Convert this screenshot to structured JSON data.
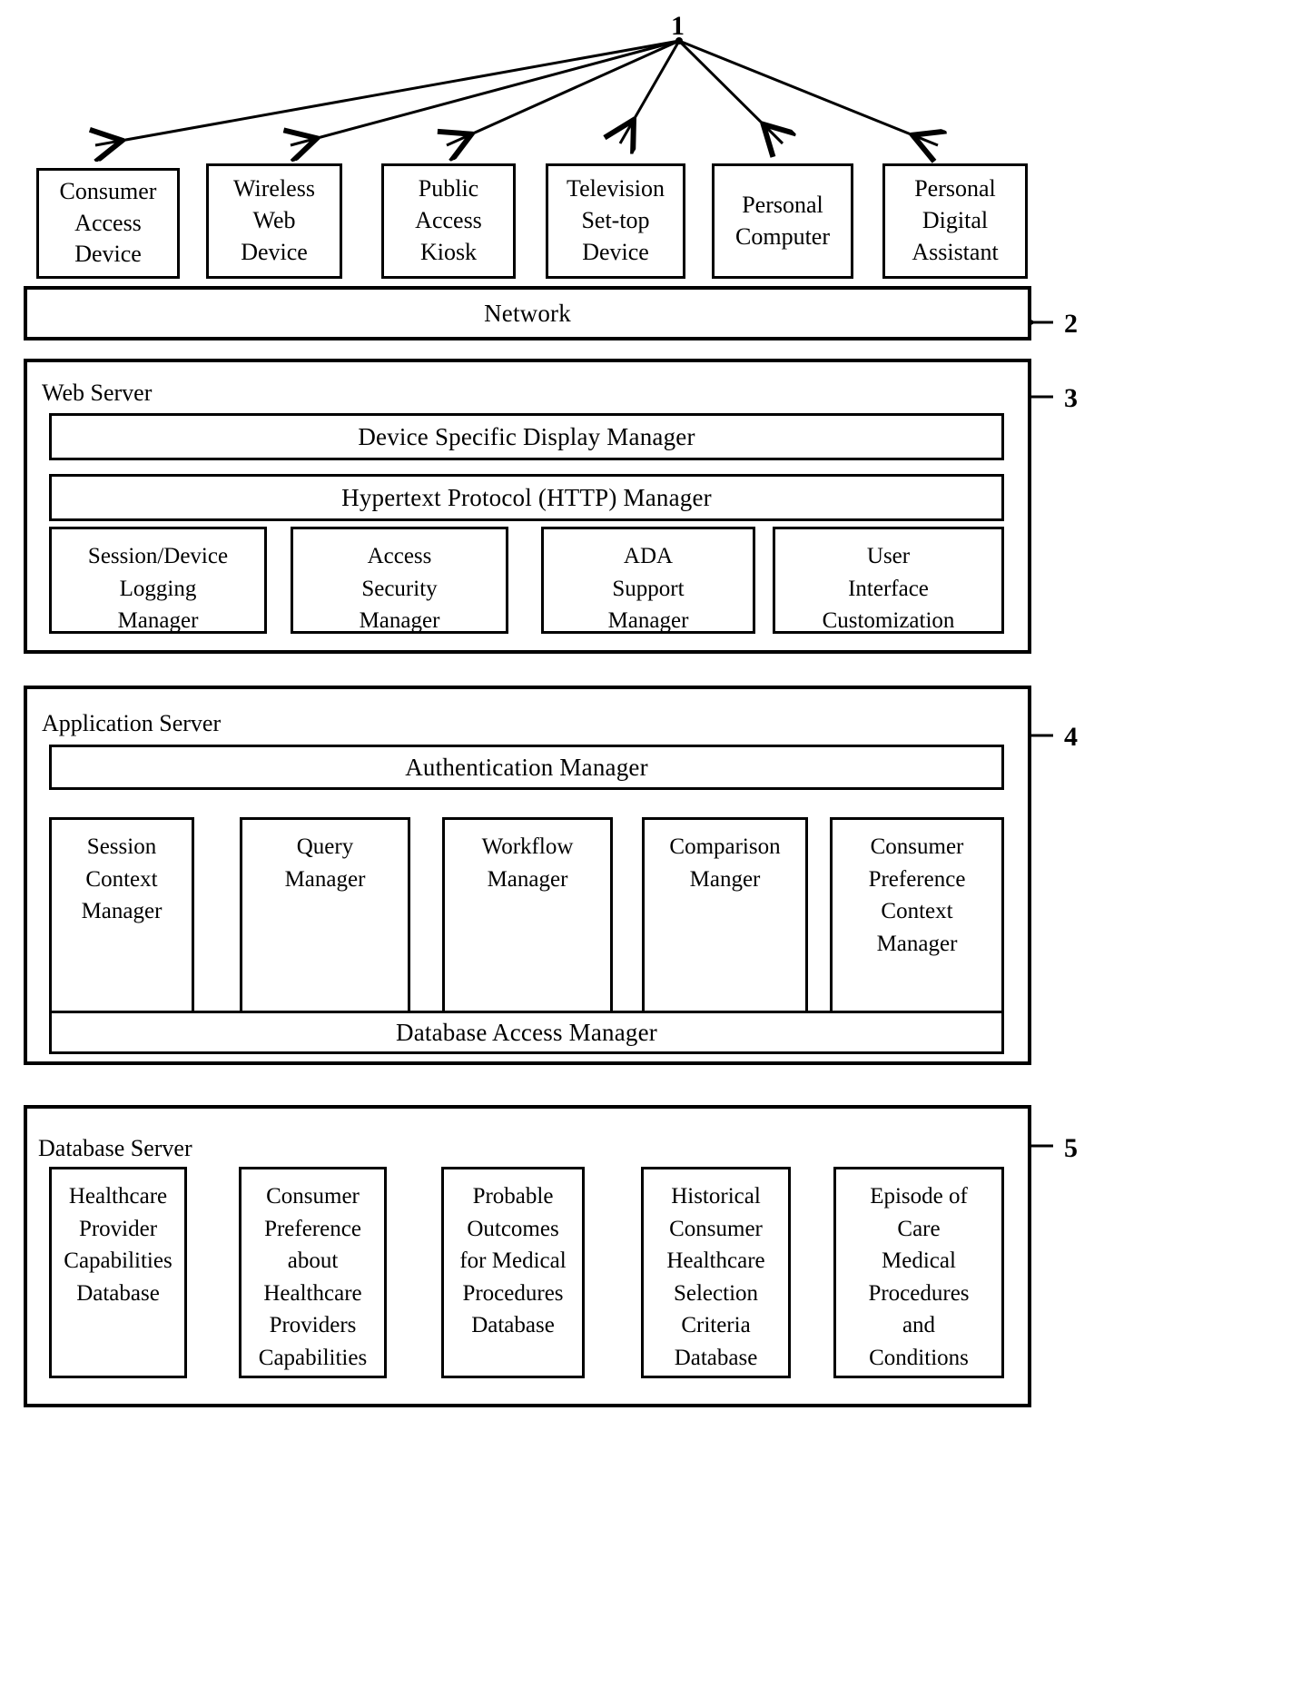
{
  "figure": {
    "type": "patent-architecture-diagram",
    "reference_numerals": {
      "devices": "1",
      "network": "2",
      "web_server": "3",
      "application_server": "4",
      "database_server": "5"
    }
  },
  "devices": {
    "numeral": "1",
    "items": [
      {
        "lines": [
          "Consumer",
          "Access",
          "Device"
        ]
      },
      {
        "lines": [
          "Wireless",
          "Web",
          "Device"
        ]
      },
      {
        "lines": [
          "Public",
          "Access",
          "Kiosk"
        ]
      },
      {
        "lines": [
          "Television",
          "Set-top",
          "Device"
        ]
      },
      {
        "lines": [
          "Personal",
          "Computer"
        ]
      },
      {
        "lines": [
          "Personal",
          "Digital",
          "Assistant"
        ]
      }
    ]
  },
  "network": {
    "label": "Network",
    "numeral": "2"
  },
  "web_server": {
    "label": "Web Server",
    "numeral": "3",
    "bars": [
      {
        "label": "Device Specific Display Manager"
      },
      {
        "label": "Hypertext Protocol (HTTP) Manager"
      }
    ],
    "modules": [
      {
        "lines": [
          "Session/Device",
          "Logging",
          "Manager"
        ]
      },
      {
        "lines": [
          "Access",
          "Security",
          "Manager"
        ]
      },
      {
        "lines": [
          "ADA",
          "Support",
          "Manager"
        ]
      },
      {
        "lines": [
          "User",
          "Interface",
          "Customization"
        ]
      }
    ]
  },
  "application_server": {
    "label": "Application Server",
    "numeral": "4",
    "top_bar": {
      "label": "Authentication Manager"
    },
    "bottom_bar": {
      "label": "Database Access Manager"
    },
    "modules": [
      {
        "lines": [
          "Session",
          "Context",
          "Manager"
        ]
      },
      {
        "lines": [
          "Query",
          "Manager"
        ]
      },
      {
        "lines": [
          "Workflow",
          "Manager"
        ]
      },
      {
        "lines": [
          "Comparison",
          "Manger"
        ]
      },
      {
        "lines": [
          "Consumer",
          "Preference",
          "Context",
          "Manager"
        ]
      }
    ]
  },
  "database_server": {
    "label": "Database Server",
    "numeral": "5",
    "databases": [
      {
        "lines": [
          "Healthcare",
          "Provider",
          "Capabilities",
          "Database"
        ]
      },
      {
        "lines": [
          "Consumer",
          "Preference",
          "about",
          "Healthcare",
          "Providers",
          "Capabilities"
        ]
      },
      {
        "lines": [
          "Probable",
          "Outcomes",
          "for Medical",
          "Procedures",
          "Database"
        ]
      },
      {
        "lines": [
          "Historical",
          "Consumer",
          "Healthcare",
          "Selection",
          "Criteria",
          "Database"
        ]
      },
      {
        "lines": [
          "Episode of",
          "Care",
          "Medical",
          "Procedures",
          "and",
          "Conditions"
        ]
      }
    ]
  },
  "colors": {
    "ink": "#000000",
    "paper": "#ffffff"
  }
}
